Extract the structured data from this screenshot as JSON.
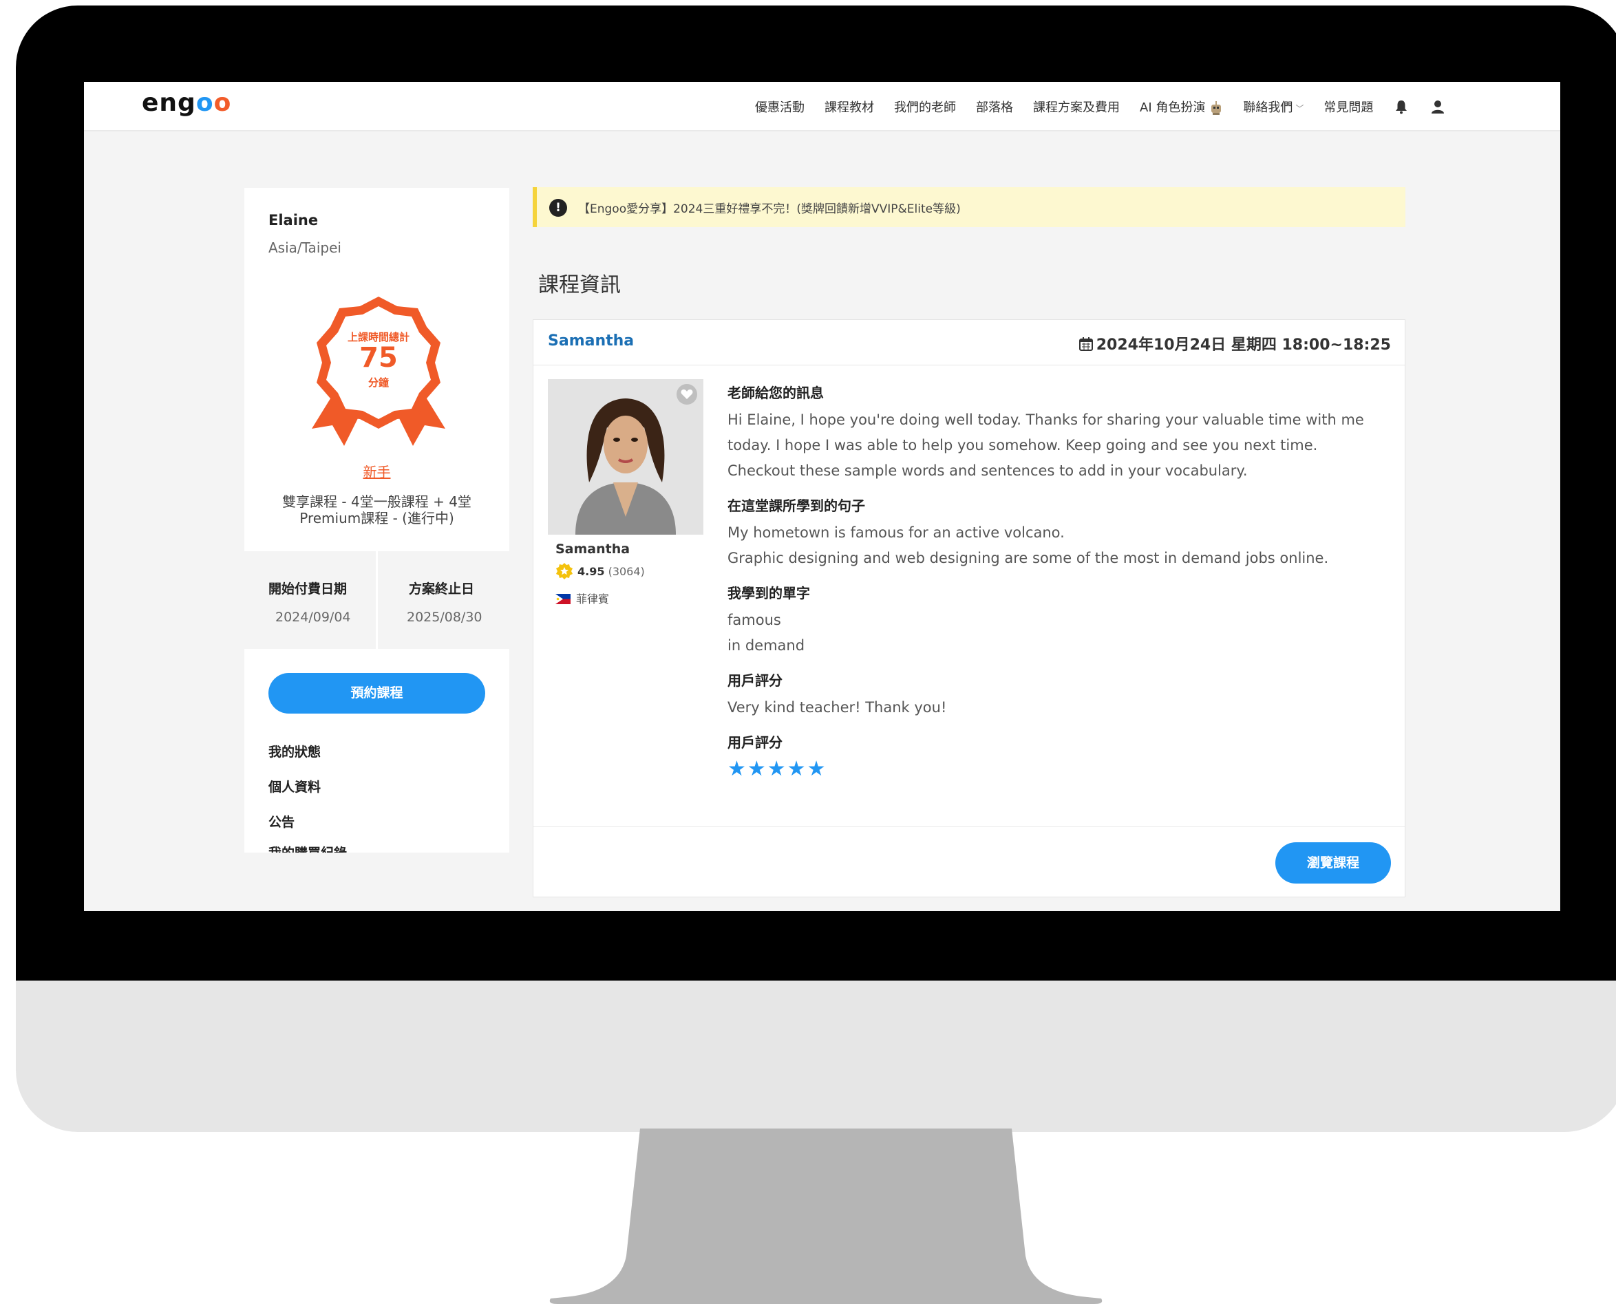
{
  "header": {
    "logo": "engoo",
    "nav": [
      "優惠活動",
      "課程教材",
      "我們的老師",
      "部落格",
      "課程方案及費用",
      "AI 角色扮演",
      "聯絡我們",
      "常見問題"
    ]
  },
  "sidebar": {
    "user_name": "Elaine",
    "timezone": "Asia/Taipei",
    "badge": {
      "title": "上課時間總計",
      "value": 75,
      "unit": "分鐘"
    },
    "level": "新手",
    "plan": "雙享課程 - 4堂一般課程 + 4堂 Premium課程 - (進行中)",
    "start_label": "開始付費日期",
    "start_date": "2024/09/04",
    "end_label": "方案終止日",
    "end_date": "2025/08/30",
    "book_button": "預約課程",
    "links": [
      "我的狀態",
      "個人資料",
      "公告",
      "我的購買紀錄"
    ]
  },
  "notice": "【Engoo愛分享】2024三重好禮享不完！(獎牌回饋新增VVIP&Elite等級)",
  "section_title": "課程資訊",
  "lesson": {
    "teacher": "Samantha",
    "datetime": "2024年10月24日 星期四 18:00~18:25",
    "rating": "4.95",
    "rating_count": "(3064)",
    "country": "菲律賓",
    "message_title": "老師給您的訊息",
    "message": "Hi Elaine, I hope you're doing well today. Thanks for sharing your valuable time with me today. I hope I was able to help you somehow. Keep going and see you next time. Checkout these sample words and sentences to add in your vocabulary.",
    "sentences_title": "在這堂課所學到的句子",
    "sentences": [
      "My hometown is famous for an active volcano.",
      "Graphic designing and web designing are some of the most in demand jobs online."
    ],
    "words_title": "我學到的單字",
    "words": [
      "famous",
      "in demand"
    ],
    "review_title": "用戶評分",
    "review": "Very kind teacher! Thank you!",
    "score_title": "用戶評分",
    "stars": "★★★★★",
    "star_count": 5,
    "browse_button": "瀏覽課程"
  },
  "colors": {
    "accent": "#2196f3",
    "badge": "#f05a28",
    "notice_bg": "#fdf8d0",
    "notice_border": "#f5d33a"
  }
}
